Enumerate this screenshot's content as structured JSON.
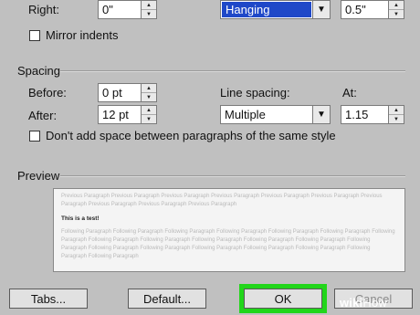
{
  "indentation": {
    "right_label": "Right:",
    "right_value": "0\"",
    "special_value": "Hanging",
    "by_value": "0.5\"",
    "mirror_label": "Mirror indents"
  },
  "spacing": {
    "section_title": "Spacing",
    "before_label": "Before:",
    "before_value": "0 pt",
    "after_label": "After:",
    "after_value": "12 pt",
    "line_spacing_label": "Line spacing:",
    "line_spacing_value": "Multiple",
    "at_label": "At:",
    "at_value": "1.15",
    "dont_add_label": "Don't add space between paragraphs of the same style"
  },
  "preview": {
    "section_title": "Preview",
    "previous_text": "Previous Paragraph Previous Paragraph Previous Paragraph Previous Paragraph Previous Paragraph Previous Paragraph Previous Paragraph Previous Paragraph Previous Paragraph Previous Paragraph",
    "current_text": "This is a test!",
    "following_text": "Following Paragraph Following Paragraph Following Paragraph Following Paragraph Following Paragraph Following Paragraph Following Paragraph Following Paragraph Following Paragraph Following Paragraph Following Paragraph Following Paragraph Following Paragraph Following Paragraph Following Paragraph Following Paragraph Following Paragraph Following Paragraph Following Paragraph Following Paragraph"
  },
  "buttons": {
    "tabs": "Tabs...",
    "default": "Default...",
    "ok": "OK",
    "cancel": "Cancel"
  },
  "watermark": {
    "wiki": "wiki",
    "how": "How"
  },
  "colors": {
    "highlight": "#22d61a",
    "selection": "#1f48c8"
  },
  "icons": {
    "spin_up": "triangle-up",
    "spin_down": "triangle-down",
    "dropdown": "chevron-down"
  }
}
